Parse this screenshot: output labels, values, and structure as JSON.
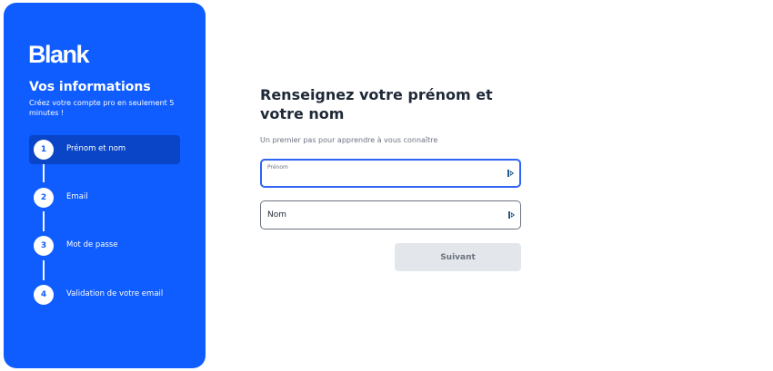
{
  "sidebar": {
    "logo": "Blank",
    "title": "Vos informations",
    "subtitle": "Créez votre compte pro en seulement 5 minutes !",
    "steps": [
      {
        "number": "1",
        "label": "Prénom et nom",
        "active": true
      },
      {
        "number": "2",
        "label": "Email",
        "active": false
      },
      {
        "number": "3",
        "label": "Mot de passe",
        "active": false
      },
      {
        "number": "4",
        "label": "Validation de votre email",
        "active": false
      }
    ]
  },
  "main": {
    "title": "Renseignez votre prénom et votre nom",
    "subtitle": "Un premier pas pour apprendre à vous connaître",
    "fields": {
      "first_name": {
        "label": "Prénom",
        "value": ""
      },
      "last_name": {
        "label": "Nom",
        "value": ""
      }
    },
    "next_button": "Suivant"
  },
  "colors": {
    "sidebar_bg": "#0f5cff",
    "active_step_bg": "#0a44c7",
    "focus_border": "#2f64f5",
    "button_disabled_bg": "#e3e6ea"
  },
  "icons": {
    "field_icon": "password-manager-icon"
  }
}
